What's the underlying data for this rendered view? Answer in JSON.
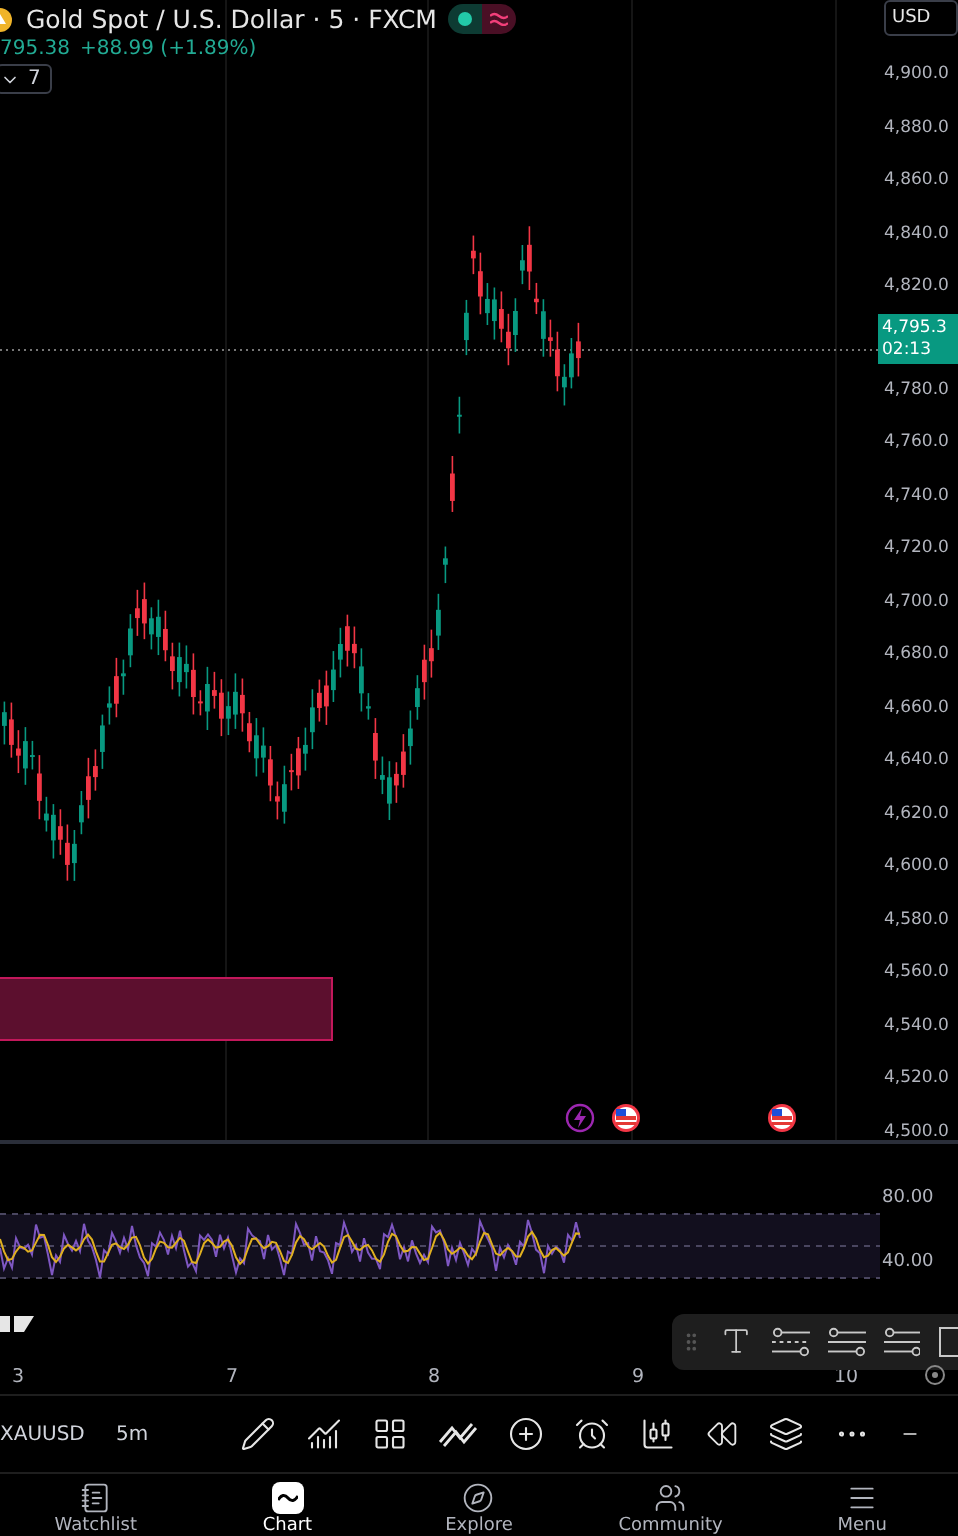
{
  "header": {
    "symbol": "Gold Spot / U.S. Dollar · 5 · FXCM",
    "last": "795.38",
    "change": "+88.99 (+1.89%)",
    "indicators_count": "7",
    "currency": "USD"
  },
  "price_axis": {
    "upper_ticks": [
      "4,900.0",
      "4,880.0",
      "4,860.0",
      "4,840.0",
      "4,820.0"
    ],
    "last_price": "4,795.3",
    "countdown": "02:13",
    "lower_ticks": [
      "4,780.0",
      "4,760.0",
      "4,740.0",
      "4,720.0",
      "4,700.0",
      "4,680.0",
      "4,660.0",
      "4,640.0",
      "4,620.0",
      "4,600.0",
      "4,580.0",
      "4,560.0",
      "4,540.0",
      "4,520.0",
      "4,500.0"
    ]
  },
  "rsi_axis": {
    "ticks": [
      "80.00",
      "40.00"
    ]
  },
  "time_axis": {
    "ticks": [
      "3",
      "7",
      "8",
      "9",
      "10"
    ]
  },
  "watchlist": [
    {
      "symbol": "XAUUSD",
      "interval": "5m"
    }
  ],
  "nav": [
    {
      "label": "Watchlist",
      "selected": false
    },
    {
      "label": "Chart",
      "selected": true
    },
    {
      "label": "Explore",
      "selected": false
    },
    {
      "label": "Community",
      "selected": false
    },
    {
      "label": "Menu",
      "selected": false
    }
  ]
}
